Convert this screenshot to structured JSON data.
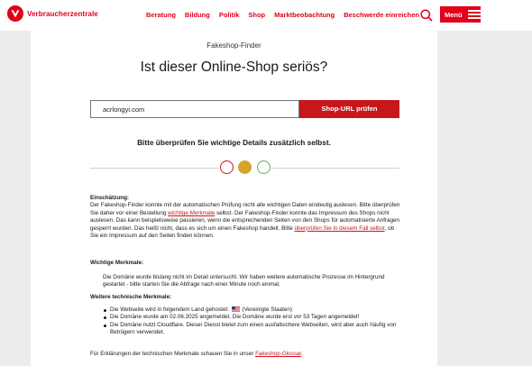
{
  "header": {
    "logo_text": "Verbraucherzentrale",
    "nav": [
      "Beratung",
      "Bildung",
      "Politik",
      "Shop",
      "Marktbeobachtung",
      "Beschwerde einreichen"
    ],
    "menu_label": "Menü",
    "brand_color": "#e2001a"
  },
  "finder": {
    "label": "Fakeshop-Finder",
    "title": "Ist dieser Online-Shop seriös?",
    "input_value": "acrlongyi.com",
    "button_label": "Shop-URL prüfen",
    "hint": "Bitte überprüfen Sie wichtige Details zusätzlich selbst.",
    "traffic_light": {
      "active": "yellow",
      "colors": {
        "red": "#c8161d",
        "yellow": "#d4a32a",
        "green": "#6ab04c"
      }
    }
  },
  "assessment": {
    "heading": "Einschätzung:",
    "p1": "Der Fakeshop-Finder konnte mit der automatischen Prüfung nicht alle wichtigen Daten eindeutig auslesen. Bitte überprüfen Sie daher vor einer Bestellung ",
    "link1": "wichtige Merkmale",
    "p2": " selbst. Der Fakeshop-Finder konnte das Impressum des Shops nicht auslesen. Das kann beispielsweise passieren, wenn die entsprechenden Seiten von den Shops für automatisierte Anfragen gesperrt wurden. Das heißt nicht, dass es sich um einen Fakeshop handelt. Bitte ",
    "link2": "überprüfen Sie in diesem Fall selbst",
    "p3": ", ob Sie ein Impressum auf den Seiten finden können."
  },
  "features": {
    "heading": "Wichtige Merkmale:",
    "text": "Die Domäne wurde bislang nicht im Detail untersucht. Wir haben weitere automatische Prozesse im Hintergrund gestartet - bitte starten Sie die Abfrage nach einer Minute noch einmal."
  },
  "technical": {
    "heading": "Weitere technische Merkmale:",
    "item1_pre": "Die Webseite wird in folgendem Land gehostet: ",
    "item1_post": " (Vereinigte Staaten)",
    "item2": "Die Domäne wurde am 02.06.2025 angemeldet. Die Domäne wurde erst vor 53 Tagen angemeldet!",
    "item3": "Die Domäne nutzt Cloudflare. Dieser Dienst bietet zum einen ausfallsichere Webseiten, wird aber auch häufig von Betrügern verwendet."
  },
  "footer": {
    "pre": "Für Erklärungen der technischen Merkmale schauen Sie in unser ",
    "link": "Fakeshop-Glossar",
    "post": "."
  }
}
